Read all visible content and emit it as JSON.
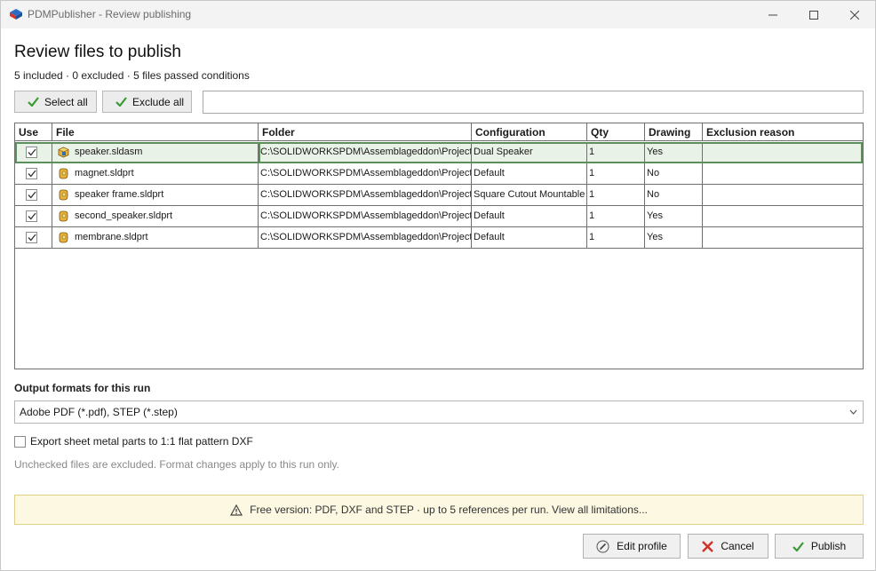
{
  "window": {
    "title": "PDMPublisher - Review publishing",
    "minimize_icon": "minimize-icon",
    "maximize_icon": "maximize-icon",
    "close_icon": "close-icon"
  },
  "page": {
    "heading": "Review files to publish",
    "summary": "5 included · 0 excluded · 5 files passed conditions"
  },
  "toolbar": {
    "select_all": "Select all",
    "exclude_all": "Exclude all",
    "search_value": ""
  },
  "grid": {
    "columns": [
      "Use",
      "File",
      "Folder",
      "Configuration",
      "Qty",
      "Drawing",
      "Exclusion reason"
    ],
    "rows": [
      {
        "use": true,
        "file": "speaker.sldasm",
        "icon": "assembly-icon",
        "folder": "C:\\SOLIDWORKSPDM\\Assemblageddon\\Projects\\",
        "configuration": "Dual Speaker",
        "qty": "1",
        "drawing": "Yes",
        "reason": ""
      },
      {
        "use": true,
        "file": "magnet.sldprt",
        "icon": "part-icon",
        "folder": "C:\\SOLIDWORKSPDM\\Assemblageddon\\Projects\\",
        "configuration": "Default",
        "qty": "1",
        "drawing": "No",
        "reason": ""
      },
      {
        "use": true,
        "file": "speaker frame.sldprt",
        "icon": "part-icon",
        "folder": "C:\\SOLIDWORKSPDM\\Assemblageddon\\Projects\\",
        "configuration": "Square Cutout Mountable",
        "qty": "1",
        "drawing": "No",
        "reason": ""
      },
      {
        "use": true,
        "file": "second_speaker.sldprt",
        "icon": "part-icon",
        "folder": "C:\\SOLIDWORKSPDM\\Assemblageddon\\Projects\\",
        "configuration": "Default",
        "qty": "1",
        "drawing": "Yes",
        "reason": ""
      },
      {
        "use": true,
        "file": "membrane.sldprt",
        "icon": "part-icon",
        "folder": "C:\\SOLIDWORKSPDM\\Assemblageddon\\Projects\\",
        "configuration": "Default",
        "qty": "1",
        "drawing": "Yes",
        "reason": ""
      }
    ]
  },
  "output": {
    "label": "Output formats for this run",
    "formats_value": "Adobe PDF (*.pdf), STEP (*.step)",
    "dxf_option": "Export sheet metal parts to 1:1 flat pattern DXF",
    "hint": "Unchecked files are excluded. Format changes apply to this run only."
  },
  "banner": {
    "text": "Free version: PDF, DXF and STEP · up to 5 references per run. View all limitations..."
  },
  "actions": {
    "edit_profile": "Edit profile",
    "cancel": "Cancel",
    "publish": "Publish"
  },
  "colors": {
    "accent_green": "#3a9a34",
    "cancel_red": "#d0302a",
    "banner_bg": "#fcf8e2",
    "selected_row": "#e9f2e6"
  }
}
